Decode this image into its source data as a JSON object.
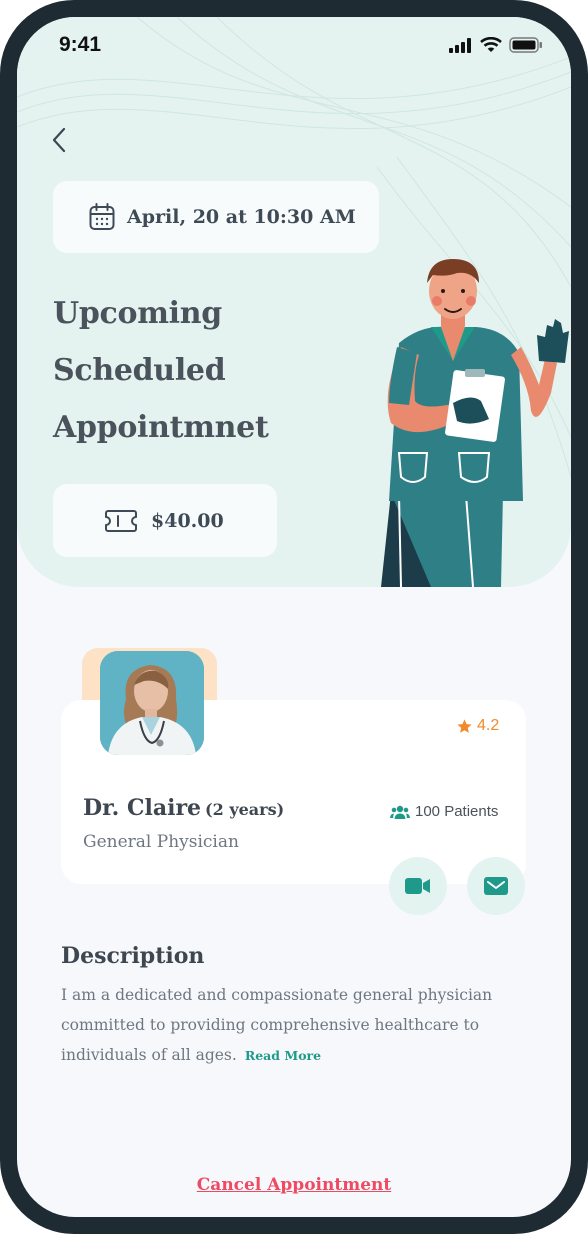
{
  "status_bar": {
    "time": "9:41"
  },
  "appointment": {
    "date_time": "April, 20 at 10:30 AM",
    "title_line1": "Upcoming Scheduled",
    "title_line2": "Appointmnet",
    "price": "$40.00"
  },
  "doctor": {
    "name": "Dr. Claire",
    "experience": "(2 years)",
    "role": "General Physician",
    "rating": "4.2",
    "patients": "100 Patients"
  },
  "description": {
    "title": "Description",
    "text": "I am a dedicated and compassionate general physician committed to providing comprehensive healthcare to individuals of all ages.",
    "read_more": "Read More"
  },
  "actions": {
    "cancel_label": "Cancel Appointment"
  },
  "colors": {
    "accent": "#1f9a8a",
    "hero_bg": "#e4f3f0",
    "danger": "#ee4b63",
    "rating": "#f08a2a"
  },
  "icons": [
    "back-arrow-icon",
    "calendar-icon",
    "ticket-icon",
    "star-icon",
    "patients-icon",
    "video-icon",
    "mail-icon"
  ]
}
